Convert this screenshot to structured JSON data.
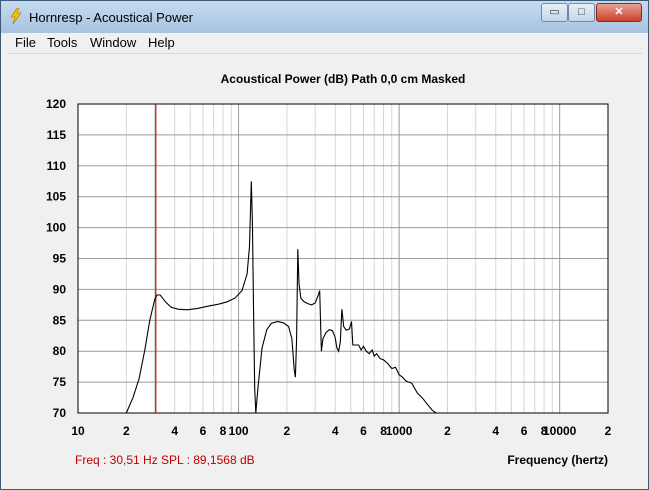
{
  "window": {
    "title": "Hornresp - Acoustical Power",
    "minimize_glyph": "▭",
    "maximize_glyph": "□",
    "close_glyph": "✕"
  },
  "menu": [
    "File",
    "Tools",
    "Window",
    "Help"
  ],
  "chart_data": {
    "type": "line",
    "title": "Acoustical Power (dB)   Path 0,0 cm   Masked",
    "xlabel": "Frequency (hertz)",
    "ylabel": "",
    "xscale": "log",
    "xlim": [
      10,
      20000
    ],
    "ylim": [
      70,
      120
    ],
    "y_ticks": [
      70,
      75,
      80,
      85,
      90,
      95,
      100,
      105,
      110,
      115,
      120
    ],
    "x_ticks": [
      {
        "v": 10,
        "label": "10"
      },
      {
        "v": 20,
        "label": "2"
      },
      {
        "v": 40,
        "label": "4"
      },
      {
        "v": 60,
        "label": "6"
      },
      {
        "v": 80,
        "label": "8"
      },
      {
        "v": 100,
        "label": "100"
      },
      {
        "v": 200,
        "label": "2"
      },
      {
        "v": 400,
        "label": "4"
      },
      {
        "v": 600,
        "label": "6"
      },
      {
        "v": 800,
        "label": "8"
      },
      {
        "v": 1000,
        "label": "1000"
      },
      {
        "v": 2000,
        "label": "2"
      },
      {
        "v": 4000,
        "label": "4"
      },
      {
        "v": 6000,
        "label": "6"
      },
      {
        "v": 8000,
        "label": "8"
      },
      {
        "v": 10000,
        "label": "10000"
      },
      {
        "v": 20000,
        "label": "2"
      }
    ],
    "grid": true,
    "cursor_x": 30.51,
    "series": [
      {
        "color": "#000000",
        "points": [
          [
            20,
            70
          ],
          [
            22,
            72.5
          ],
          [
            24,
            75.5
          ],
          [
            26,
            80
          ],
          [
            28,
            85
          ],
          [
            30,
            88.3
          ],
          [
            31,
            89.1
          ],
          [
            32.5,
            89.1
          ],
          [
            35,
            88
          ],
          [
            38,
            87.1
          ],
          [
            42,
            86.8
          ],
          [
            48,
            86.7
          ],
          [
            55,
            86.9
          ],
          [
            65,
            87.3
          ],
          [
            75,
            87.6
          ],
          [
            85,
            88
          ],
          [
            95,
            88.6
          ],
          [
            105,
            89.8
          ],
          [
            113,
            92.5
          ],
          [
            117,
            97
          ],
          [
            120,
            107.5
          ],
          [
            122,
            101
          ],
          [
            124,
            86
          ],
          [
            126,
            74
          ],
          [
            128,
            70
          ],
          [
            132,
            74
          ],
          [
            140,
            80.5
          ],
          [
            150,
            83.5
          ],
          [
            160,
            84.5
          ],
          [
            175,
            84.8
          ],
          [
            190,
            84.6
          ],
          [
            205,
            84
          ],
          [
            215,
            82
          ],
          [
            222,
            77
          ],
          [
            226,
            75.8
          ],
          [
            230,
            82
          ],
          [
            234,
            96.5
          ],
          [
            238,
            91
          ],
          [
            244,
            88.6
          ],
          [
            256,
            88
          ],
          [
            270,
            87.7
          ],
          [
            285,
            87.5
          ],
          [
            300,
            87.8
          ],
          [
            313,
            89
          ],
          [
            320,
            89.8
          ],
          [
            324,
            85
          ],
          [
            328,
            80
          ],
          [
            335,
            82
          ],
          [
            350,
            83
          ],
          [
            368,
            83.5
          ],
          [
            385,
            83.3
          ],
          [
            400,
            82.2
          ],
          [
            410,
            80.5
          ],
          [
            420,
            80
          ],
          [
            430,
            81.5
          ],
          [
            440,
            86.8
          ],
          [
            452,
            84
          ],
          [
            468,
            83.4
          ],
          [
            490,
            83.6
          ],
          [
            505,
            84.8
          ],
          [
            515,
            81
          ],
          [
            530,
            81
          ],
          [
            560,
            81
          ],
          [
            580,
            80.2
          ],
          [
            600,
            80.8
          ],
          [
            625,
            80
          ],
          [
            650,
            79.6
          ],
          [
            680,
            80.2
          ],
          [
            700,
            79.2
          ],
          [
            725,
            79.6
          ],
          [
            760,
            78.8
          ],
          [
            800,
            78.6
          ],
          [
            850,
            78
          ],
          [
            900,
            77.2
          ],
          [
            950,
            77.4
          ],
          [
            1000,
            76.2
          ],
          [
            1050,
            75.8
          ],
          [
            1100,
            75.2
          ],
          [
            1200,
            74.8
          ],
          [
            1300,
            73.2
          ],
          [
            1400,
            72.4
          ],
          [
            1500,
            71.4
          ],
          [
            1600,
            70.5
          ],
          [
            1700,
            70
          ]
        ]
      }
    ]
  },
  "status": {
    "freq": "Freq : 30,51 Hz",
    "spl": "SPL : 89,1568 dB"
  }
}
